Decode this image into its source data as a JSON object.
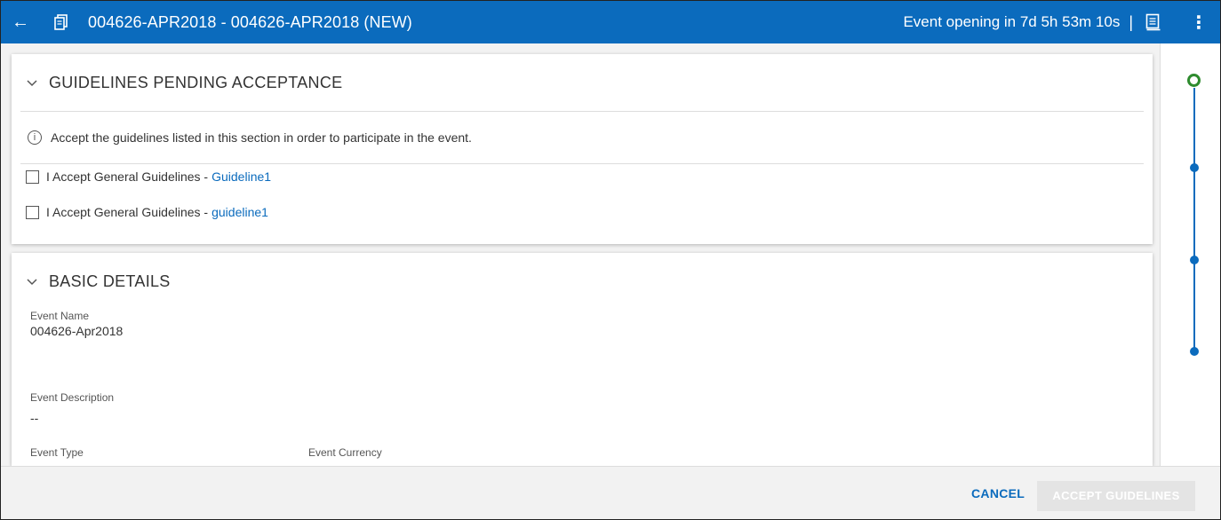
{
  "header": {
    "back_icon": "←",
    "title": "004626-APR2018 - 004626-APR2018 (NEW)",
    "countdown": "Event opening in  7d 5h 53m 10s",
    "separator": "|",
    "more_icon": "⋮",
    "bar_color": "#0b6bbd"
  },
  "guidelines": {
    "section_title": "GUIDELINES PENDING ACCEPTANCE",
    "info_icon": "i",
    "info_text": "Accept the guidelines listed in this section in order to participate in the event.",
    "items": [
      {
        "label": "I Accept General Guidelines -",
        "link": "Guideline1",
        "checked": false
      },
      {
        "label": "I Accept General Guidelines -",
        "link": "guideline1",
        "checked": false
      }
    ]
  },
  "drag_handle": "::::",
  "basic_details": {
    "section_title": "BASIC DETAILS",
    "event_name_label": "Event Name",
    "event_name_value": "004626-Apr2018",
    "event_description_label": "Event Description",
    "event_description_value": "--",
    "event_type_label": "Event Type",
    "event_currency_label": "Event Currency"
  },
  "footer": {
    "cancel_label": "CANCEL",
    "accept_label": "ACCEPT GUIDELINES"
  },
  "progress": {
    "current_color": "#2e8b2e",
    "step_color": "#0b6bbd"
  }
}
